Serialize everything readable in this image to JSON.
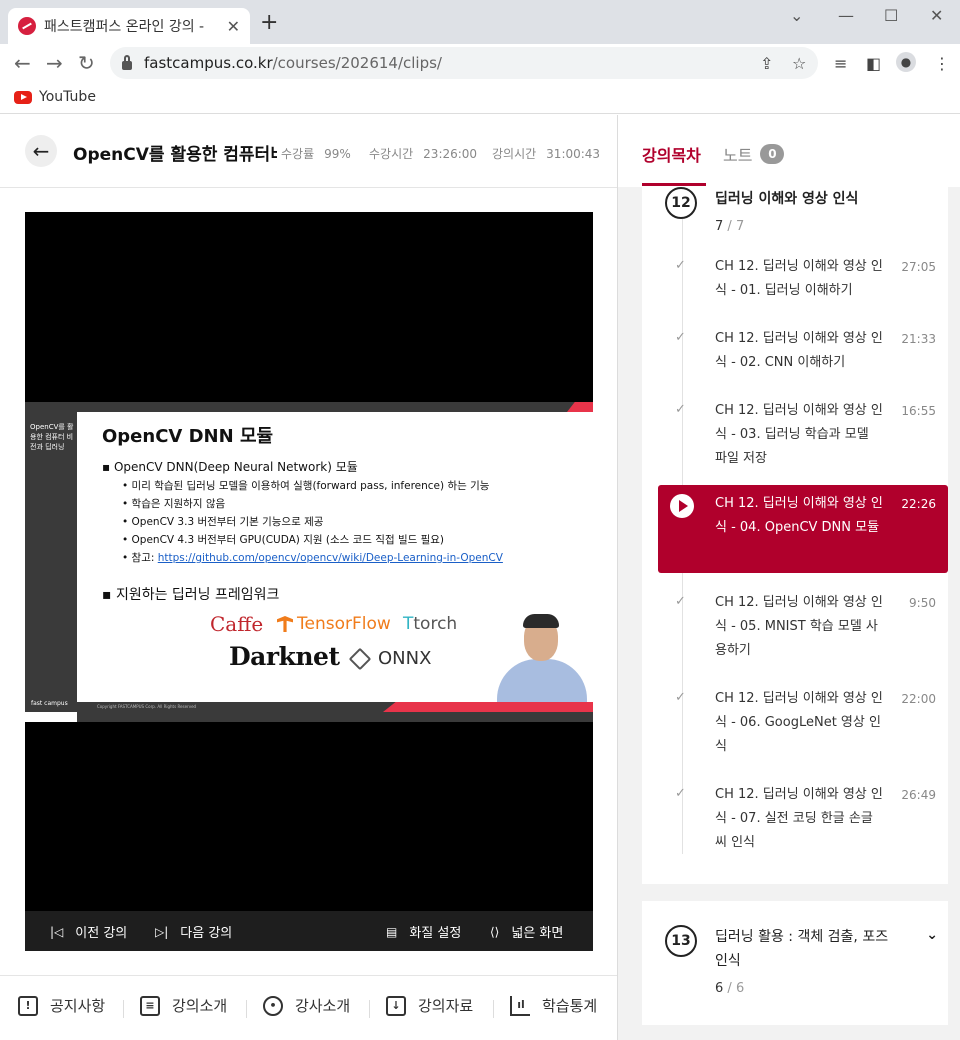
{
  "browser": {
    "tab_title": "패스트캠퍼스 온라인 강의 -",
    "tab_close": "✕",
    "new_tab": "+",
    "url_host": "fastcampus.co.kr",
    "url_path": "/courses/202614/clips/",
    "bookmark_youtube": "YouTube",
    "icons": [
      "back-icon",
      "forward-icon",
      "reload-icon",
      "lock-icon",
      "share-icon",
      "star-icon",
      "media-icon",
      "sidepanel-icon",
      "profile-icon",
      "menu-icon"
    ]
  },
  "course": {
    "title": "OpenCV를 활용한 컴퓨터비",
    "progress_label": "수강률",
    "progress_value": "99%",
    "watch_time_label": "수강시간",
    "watch_time_value": "23:26:00",
    "lecture_time_label": "강의시간",
    "lecture_time_value": "31:00:43"
  },
  "slide": {
    "side_title": "OpenCV를 활용한 컴퓨터 비전과 딥러닝",
    "side_logo": "fast campus",
    "copyright": "Copyright FASTCAMPUS Corp. All Rights Reserved",
    "heading": "OpenCV DNN 모듈",
    "bullet1": "▪ OpenCV DNN(Deep Neural Network) 모듈",
    "sub_bullets": [
      "• 미리 학습된 딥러닝 모델을 이용하여 실행(forward pass, inference) 하는 기능",
      "• 학습은 지원하지 않음",
      "• OpenCV 3.3 버전부터 기본 기능으로 제공",
      "• OpenCV 4.3 버전부터 GPU(CUDA) 지원 (소스 코드 직접 빌드 필요)"
    ],
    "ref_label": "• 참고: ",
    "ref_link": "https://github.com/opencv/opencv/wiki/Deep-Learning-in-OpenCV",
    "bullet2": "▪ 지원하는 딥러닝 프레임워크",
    "logos": {
      "caffe": "Caffe",
      "tensorflow": "TensorFlow",
      "torch_t": "T",
      "torch": "torch",
      "darknet": "Darknet",
      "onnx": "ONNX"
    }
  },
  "player": {
    "prev": "이전 강의",
    "next": "다음 강의",
    "quality": "화질 설정",
    "wide": "넓은 화면"
  },
  "bottom_nav": [
    "공지사항",
    "강의소개",
    "강사소개",
    "강의자료",
    "학습통계"
  ],
  "panel": {
    "tab_toc": "강의목차",
    "tab_note": "노트",
    "note_count": "0",
    "section12": {
      "number": "12",
      "title": "딥러닝 이해와 영상 인식",
      "done": "7",
      "total": "7"
    },
    "clips": [
      {
        "title": "CH 12. 딥러닝 이해와 영상 인식 - 01. 딥러닝 이해하기",
        "time": "27:05"
      },
      {
        "title": "CH 12. 딥러닝 이해와 영상 인식 - 02. CNN 이해하기",
        "time": "21:33"
      },
      {
        "title": "CH 12. 딥러닝 이해와 영상 인식 - 03. 딥러닝 학습과 모델 파일 저장",
        "time": "16:55"
      },
      {
        "title": "CH 12. 딥러닝 이해와 영상 인식 - 04. OpenCV DNN 모듈",
        "time": "22:26"
      },
      {
        "title": "CH 12. 딥러닝 이해와 영상 인식 - 05. MNIST 학습 모델 사용하기",
        "time": "9:50"
      },
      {
        "title": "CH 12. 딥러닝 이해와 영상 인식 - 06. GoogLeNet 영상 인식",
        "time": "22:00"
      },
      {
        "title": "CH 12. 딥러닝 이해와 영상 인식 - 07. 실전 코딩 한글 손글씨 인식",
        "time": "26:49"
      }
    ],
    "section13": {
      "number": "13",
      "title": "딥러닝 활용 : 객체 검출, 포즈 인식",
      "done": "6",
      "total": "6"
    }
  },
  "colors": {
    "accent": "#b0002c",
    "slide_red": "#e8344a",
    "player_bg": "#000000"
  }
}
